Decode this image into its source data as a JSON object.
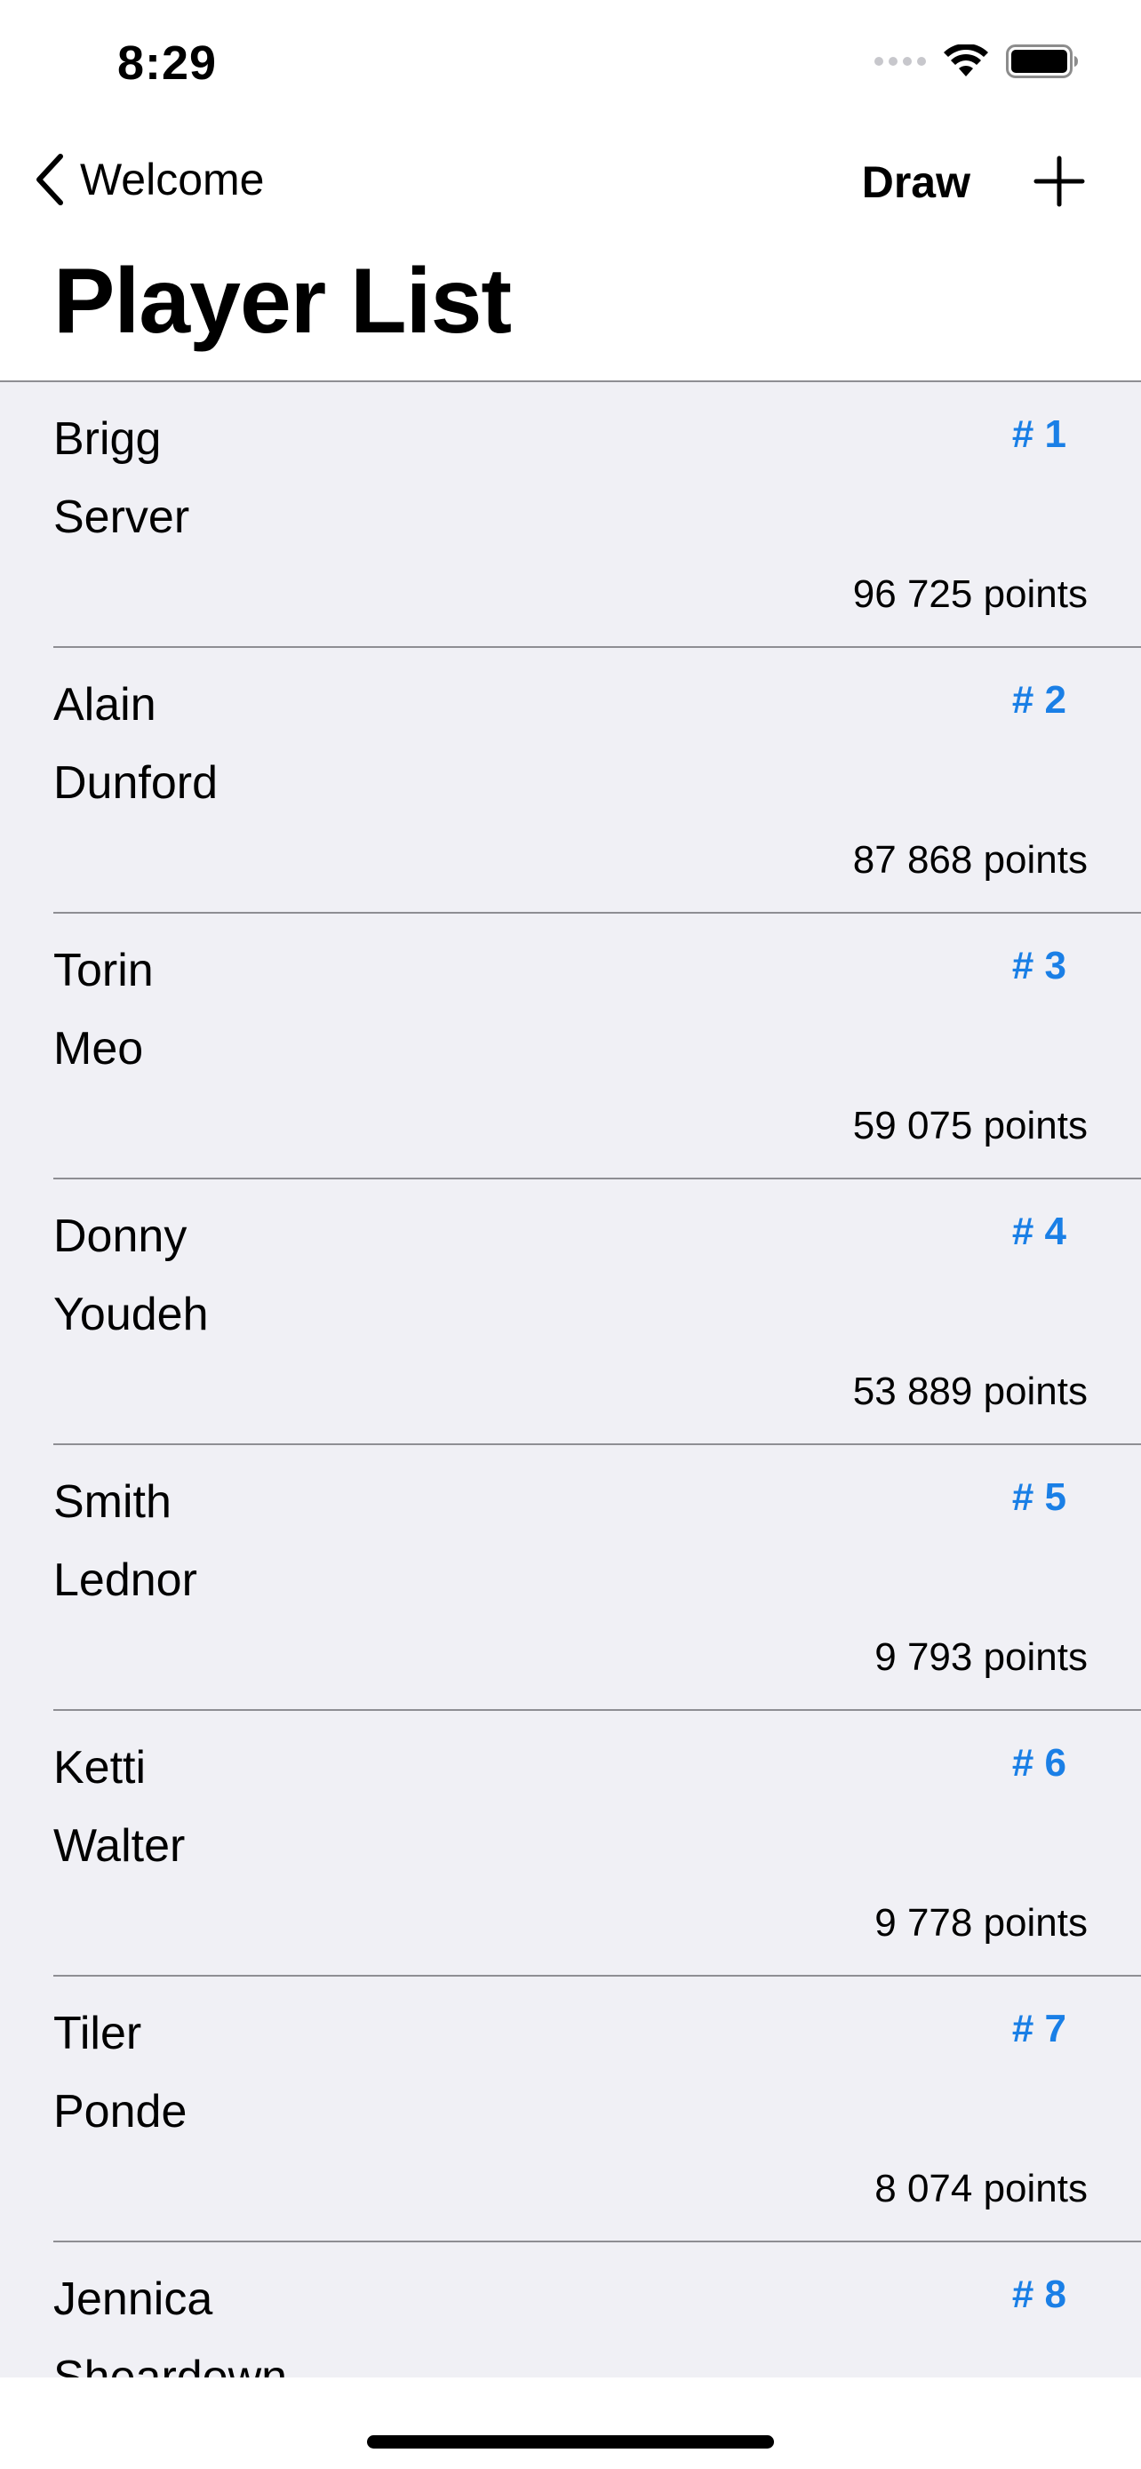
{
  "status_bar": {
    "time": "8:29"
  },
  "nav": {
    "back_label": "Welcome",
    "draw_label": "Draw",
    "title": "Player List"
  },
  "icons": {
    "back": "chevron-left-icon",
    "add": "plus-icon",
    "signal": "cellular-signal-icon",
    "wifi": "wifi-icon",
    "battery": "battery-icon"
  },
  "colors": {
    "accent": "#1a7fe6",
    "list_background": "#f0f0f5"
  },
  "players": [
    {
      "first": "Brigg",
      "last": "Server",
      "rank": "# 1",
      "points": "96 725 points"
    },
    {
      "first": "Alain",
      "last": "Dunford",
      "rank": "# 2",
      "points": "87 868 points"
    },
    {
      "first": "Torin",
      "last": "Meo",
      "rank": "# 3",
      "points": "59 075 points"
    },
    {
      "first": "Donny",
      "last": "Youdeh",
      "rank": "# 4",
      "points": "53 889 points"
    },
    {
      "first": "Smith",
      "last": "Lednor",
      "rank": "# 5",
      "points": "9 793 points"
    },
    {
      "first": "Ketti",
      "last": "Walter",
      "rank": "# 6",
      "points": "9 778 points"
    },
    {
      "first": "Tiler",
      "last": "Ponde",
      "rank": "# 7",
      "points": "8 074 points"
    },
    {
      "first": "Jennica",
      "last": "Sheardown",
      "rank": "# 8",
      "points": ""
    }
  ]
}
